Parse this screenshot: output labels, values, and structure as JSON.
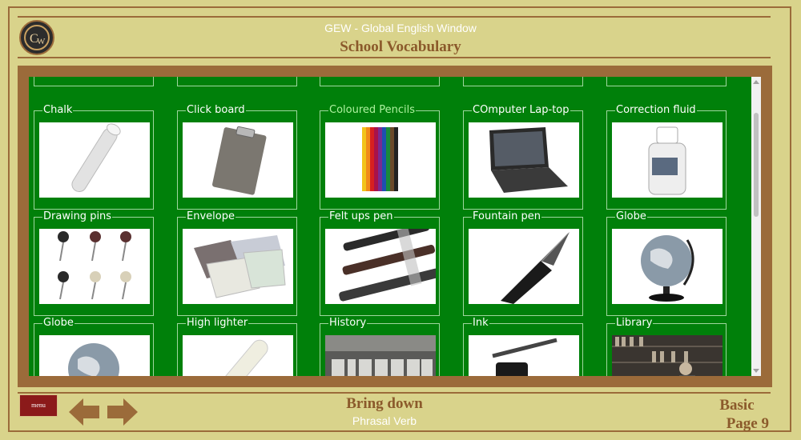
{
  "header": {
    "app_title": "GEW - Global English Window",
    "page_title": "School Vocabulary"
  },
  "vocabulary": {
    "items": [
      {
        "label": "Chalk",
        "icon": "chalk-image"
      },
      {
        "label": "Click board",
        "icon": "clipboard-image"
      },
      {
        "label": "Coloured Pencils",
        "icon": "coloured-pencils-image",
        "highlighted": true
      },
      {
        "label": "COmputer Lap-top",
        "icon": "laptop-image"
      },
      {
        "label": "Correction fluid",
        "icon": "correction-fluid-image"
      },
      {
        "label": "Drawing pins",
        "icon": "drawing-pins-image"
      },
      {
        "label": "Envelope",
        "icon": "envelope-image"
      },
      {
        "label": "Felt ups pen",
        "icon": "felt-pens-image"
      },
      {
        "label": "Fountain pen",
        "icon": "fountain-pen-image"
      },
      {
        "label": "Globe",
        "icon": "globe-image"
      },
      {
        "label": "Globe",
        "icon": "globe-image"
      },
      {
        "label": "High lighter",
        "icon": "highlighter-image"
      },
      {
        "label": "History",
        "icon": "history-image"
      },
      {
        "label": "Ink",
        "icon": "ink-image"
      },
      {
        "label": "Library",
        "icon": "library-image"
      }
    ]
  },
  "footer": {
    "menu_label": "menu",
    "title": "Bring down",
    "subtitle": "Phrasal Verb",
    "level": "Basic",
    "page": "Page 9"
  },
  "colors": {
    "background": "#d9d38b",
    "frame": "#9b6b3a",
    "board": "#00800a",
    "title": "#8b5a2b",
    "menu": "#8b1a1a"
  }
}
